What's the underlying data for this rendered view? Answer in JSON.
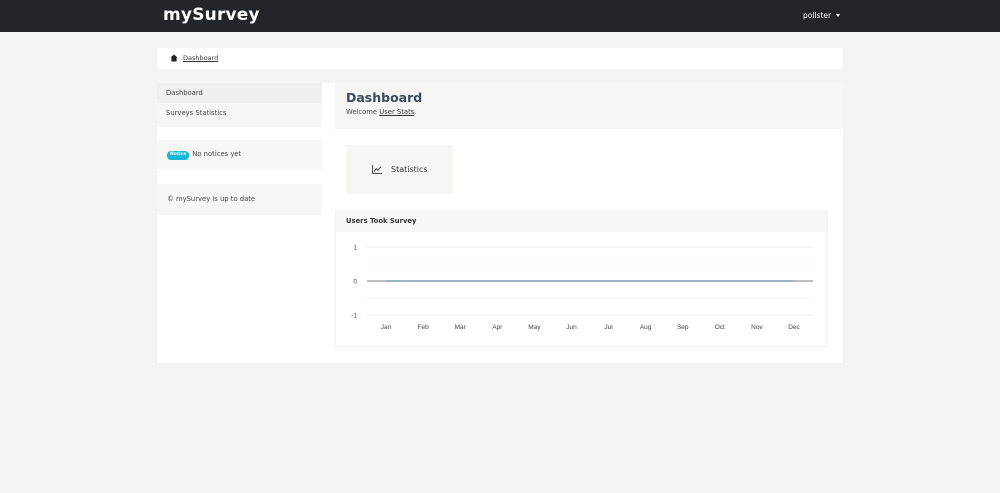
{
  "header": {
    "brand": "mySurvey",
    "user": "pollster"
  },
  "breadcrumb": {
    "items": [
      "Dashboard"
    ]
  },
  "sidebar": {
    "menu": [
      {
        "label": "Dashboard"
      },
      {
        "label": "Surveys Statistics"
      }
    ],
    "notice": {
      "badge": "Notice",
      "text": "No notices yet"
    },
    "status": "© mySurvey is up to date"
  },
  "main": {
    "title": "Dashboard",
    "welcome_prefix": "Welcome",
    "welcome_link": "User Stats",
    "welcome_suffix": ".",
    "stats_card_label": "Statistics"
  },
  "colors": {
    "topbar": "#22262b",
    "badge": "#17b8d6",
    "line": "#3d6b8a"
  },
  "icons": {
    "breadcrumb": "home-icon",
    "stats": "line-chart-icon"
  },
  "chart_data": {
    "type": "line",
    "title": "Users Took Survey",
    "categories": [
      "Jan",
      "Feb",
      "Mar",
      "Apr",
      "May",
      "Jun",
      "Jul",
      "Aug",
      "Sep",
      "Oct",
      "Nov",
      "Dec"
    ],
    "series": [
      {
        "values": [
          0,
          0,
          0,
          0,
          0,
          0,
          0,
          0,
          0,
          0,
          0,
          0
        ]
      }
    ],
    "y_ticks": [
      1,
      0,
      -1
    ],
    "ylim": [
      -1,
      1
    ],
    "grid": true
  }
}
